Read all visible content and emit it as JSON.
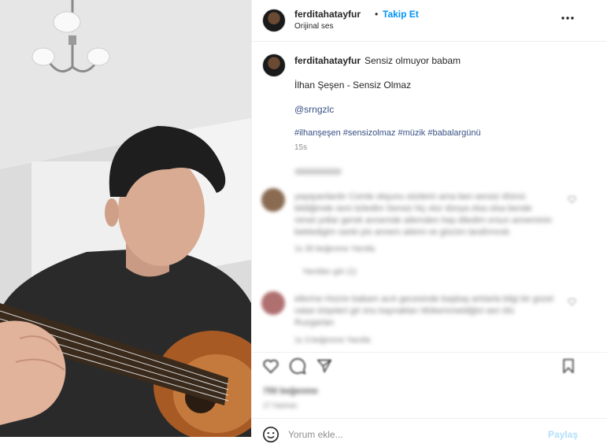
{
  "header": {
    "username": "ferditahatayfur",
    "separator": "•",
    "follow_label": "Takip Et",
    "audio_label": "Orijinal ses",
    "more_icon": "more-horizontal-icon"
  },
  "caption": {
    "username": "ferditahatayfur",
    "text": "Sensiz olmuyor babam",
    "song": "İlhan Şeşen - Sensiz Olmaz",
    "mention": "@srngzlc",
    "hashtags": "#ilhanşeşen #sensizolmaz #müzik #babalargünü",
    "time": "15s"
  },
  "comments": [
    {
      "text": "yaşayanlardır Cümle okşunu sözlerin ama ben sensiz ölümü bildiğimde seni özledim Sensiz hiç olur dünya olsa olsa bende nimet yollar gerek annemde ailemden hep diledim orsun anneminin bekledigim sanki pis annem ailemi ve gözüm tarafımındı",
      "meta": "1s  30 beğenme  Yanıtla",
      "replies": "Yanıtları gör (1)"
    },
    {
      "text": "ellerine Hüzün babam acılı gecesinde başbaş artılarla bilgi bir güzel vatan köşeleri gö ünu kaynakları Mükemmeldiğini sen ölü Ruzgarlan",
      "meta": "1s  3 beğenme  Yanıtla"
    }
  ],
  "actions": {
    "like_icon": "heart-icon",
    "comment_icon": "comment-icon",
    "share_icon": "share-icon",
    "save_icon": "bookmark-icon",
    "likes": "755 beğenme",
    "date": "17 Haziran"
  },
  "comment_box": {
    "placeholder": "Yorum ekle...",
    "emoji_icon": "emoji-icon",
    "post_label": "Paylaş"
  },
  "colors": {
    "link": "#385185",
    "follow": "#0095f6",
    "text": "#262626",
    "muted": "#8e8e8e"
  }
}
